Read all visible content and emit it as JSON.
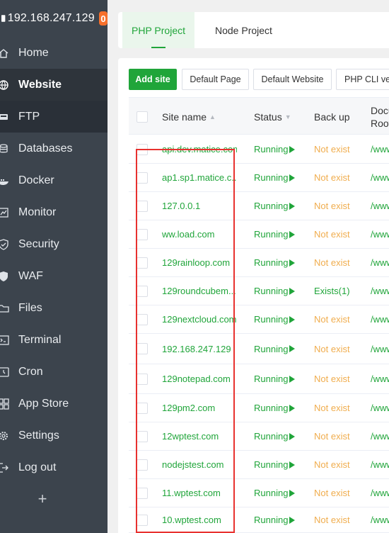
{
  "sidebar": {
    "server_ip": "192.168.247.129",
    "badge_count": "0",
    "items": [
      {
        "label": "Home",
        "icon": "home-icon"
      },
      {
        "label": "Website",
        "icon": "globe-icon",
        "active": true
      },
      {
        "label": "FTP",
        "icon": "ftp-icon"
      },
      {
        "label": "Databases",
        "icon": "database-icon"
      },
      {
        "label": "Docker",
        "icon": "docker-icon"
      },
      {
        "label": "Monitor",
        "icon": "monitor-icon"
      },
      {
        "label": "Security",
        "icon": "shield-icon"
      },
      {
        "label": "WAF",
        "icon": "waf-shield-icon"
      },
      {
        "label": "Files",
        "icon": "folder-icon"
      },
      {
        "label": "Terminal",
        "icon": "terminal-icon"
      },
      {
        "label": "Cron",
        "icon": "clock-icon"
      },
      {
        "label": "App Store",
        "icon": "grid-icon"
      },
      {
        "label": "Settings",
        "icon": "gear-icon"
      },
      {
        "label": "Log out",
        "icon": "logout-icon"
      }
    ],
    "add_label": "+"
  },
  "tabs": [
    {
      "label": "PHP Project",
      "active": true
    },
    {
      "label": "Node Project",
      "active": false
    }
  ],
  "toolbar": {
    "add_site": "Add site",
    "default_page": "Default Page",
    "default_website": "Default Website",
    "php_cli": "PHP CLI ver"
  },
  "table": {
    "headers": {
      "site_name": "Site name",
      "status": "Status",
      "backup": "Back up",
      "root_line1": "Docu",
      "root_line2": "Root"
    },
    "rows": [
      {
        "name": "api.dev.matice.com",
        "status": "Running",
        "backup": "Not exist",
        "root": "/www"
      },
      {
        "name": "ap1.sp1.matice.c...",
        "status": "Running",
        "backup": "Not exist",
        "root": "/www"
      },
      {
        "name": "127.0.0.1",
        "status": "Running",
        "backup": "Not exist",
        "root": "/www"
      },
      {
        "name": "ww.load.com",
        "status": "Running",
        "backup": "Not exist",
        "root": "/www"
      },
      {
        "name": "129rainloop.com",
        "status": "Running",
        "backup": "Not exist",
        "root": "/www"
      },
      {
        "name": "129roundcubem...",
        "status": "Running",
        "backup": "Exists(1)",
        "root": "/www"
      },
      {
        "name": "129nextcloud.com",
        "status": "Running",
        "backup": "Not exist",
        "root": "/www"
      },
      {
        "name": "192.168.247.129",
        "status": "Running",
        "backup": "Not exist",
        "root": "/www"
      },
      {
        "name": "129notepad.com",
        "status": "Running",
        "backup": "Not exist",
        "root": "/www"
      },
      {
        "name": "129pm2.com",
        "status": "Running",
        "backup": "Not exist",
        "root": "/www"
      },
      {
        "name": "12wptest.com",
        "status": "Running",
        "backup": "Not exist",
        "root": "/www"
      },
      {
        "name": "nodejstest.com",
        "status": "Running",
        "backup": "Not exist",
        "root": "/www"
      },
      {
        "name": "11.wptest.com",
        "status": "Running",
        "backup": "Not exist",
        "root": "/www"
      },
      {
        "name": "10.wptest.com",
        "status": "Running",
        "backup": "Not exist",
        "root": "/www"
      }
    ]
  },
  "colors": {
    "sidebar_bg": "#3c444d",
    "accent": "#20a53a",
    "warning": "#f0ad4e",
    "badge": "#f7702b",
    "highlight": "#e8312f"
  }
}
